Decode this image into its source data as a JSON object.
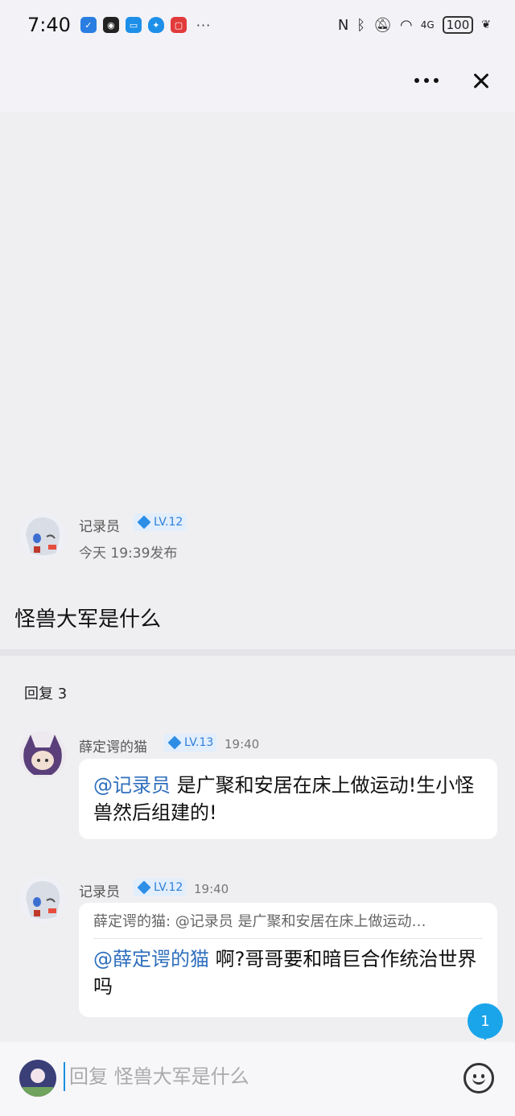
{
  "status_bar": {
    "time": "7:40",
    "more": "···",
    "battery": "100",
    "network": "4G",
    "app_icons": [
      {
        "name": "shield-app-icon",
        "color": "#2a7de1"
      },
      {
        "name": "game-app-icon",
        "color": "#222222"
      },
      {
        "name": "message-app-icon",
        "color": "#1d8fe8"
      },
      {
        "name": "security-app-icon",
        "color": "#1d8fe8"
      },
      {
        "name": "video-app-icon",
        "color": "#e23b3b"
      }
    ]
  },
  "nav": {
    "more_icon": "more-dots-icon",
    "close_icon": "close-icon"
  },
  "post": {
    "author": "记录员",
    "level": "LV.12",
    "time": "今天 19:39发布",
    "content": "怪兽大军是什么"
  },
  "replies_header": "回复 3",
  "replies": [
    {
      "author": "薛定谔的猫",
      "level": "LV.13",
      "time": "19:40",
      "mention": "@记录员",
      "text": " 是广聚和安居在床上做运动!生小怪兽然后组建的!"
    },
    {
      "author": "记录员",
      "level": "LV.12",
      "time": "19:40",
      "quote": "薛定谔的猫: @记录员 是广聚和安居在床上做运动…",
      "mention": "@薛定谔的猫",
      "text": " 啊?哥哥要和暗巨合作统治世界吗"
    }
  ],
  "unread_count": "1",
  "input": {
    "placeholder": "回复 怪兽大军是什么",
    "value": ""
  },
  "colors": {
    "accent": "#1aa5ea",
    "mention": "#2f6fbd",
    "level_badge": "#2d7fd9"
  }
}
